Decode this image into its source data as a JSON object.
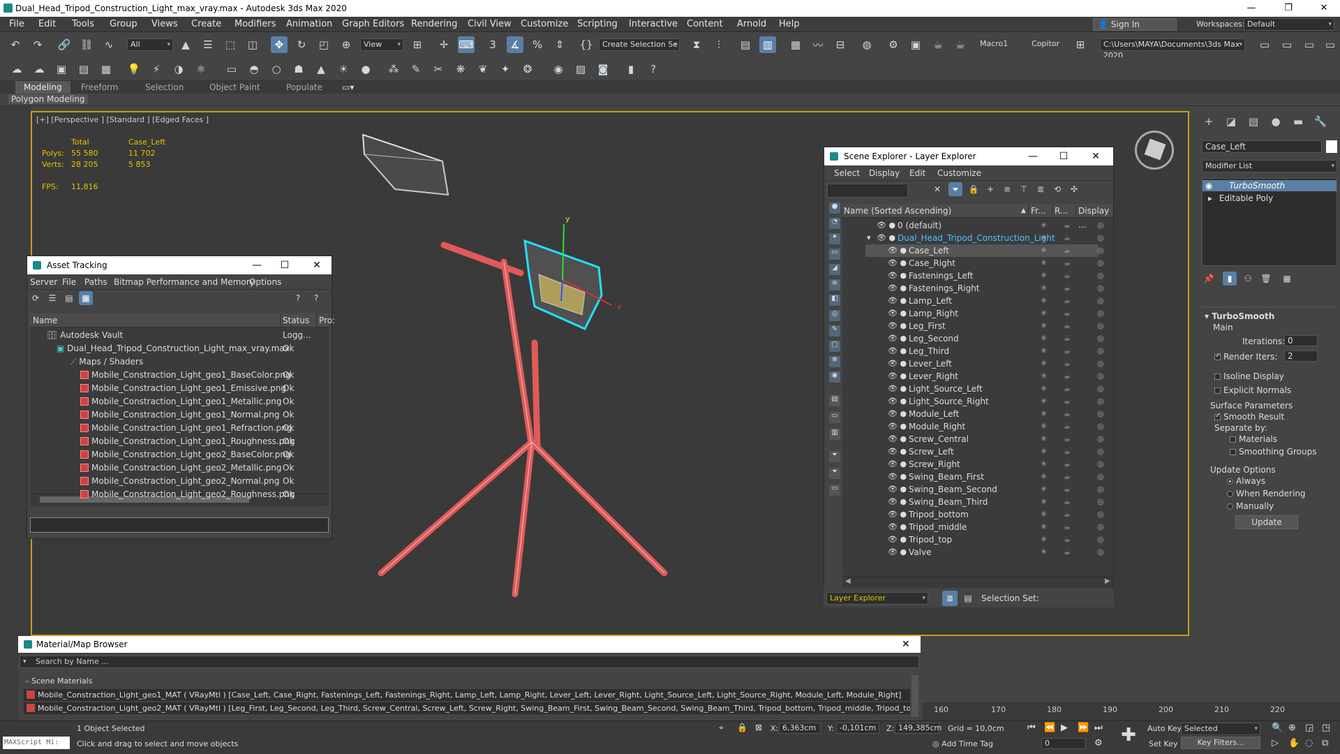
{
  "window": {
    "title": "Dual_Head_Tripod_Construction_Light_max_vray.max - Autodesk 3ds Max 2020",
    "min": "—",
    "max": "❐",
    "close": "✕"
  },
  "menus": [
    "File",
    "Edit",
    "Tools",
    "Group",
    "Views",
    "Create",
    "Modifiers",
    "Animation",
    "Graph Editors",
    "Rendering",
    "Civil View",
    "Customize",
    "Scripting",
    "Interactive",
    "Content",
    "Arnold",
    "Help"
  ],
  "account": {
    "sign_in": "Sign In",
    "workspaces_label": "Workspaces:",
    "workspace": "Default"
  },
  "toolbar": {
    "filter": "All",
    "view": "View",
    "selection_set": "Create Selection Se",
    "macro1": "Macro1",
    "copitor": "Copitor",
    "path": "C:\\Users\\MAYA\\Documents\\3ds Max 2020"
  },
  "ribbon": {
    "tabs": [
      "Modeling",
      "Freeform",
      "Selection",
      "Object Paint",
      "Populate"
    ],
    "active_tab": "Modeling",
    "subpanel": "Polygon Modeling"
  },
  "viewport": {
    "label": "[+] [Perspective ] [Standard ] [Edged Faces ]",
    "stats": {
      "col_total": "Total",
      "col_object": "Case_Left",
      "polys_label": "Polys:",
      "polys_total": "55 580",
      "polys_obj": "11 702",
      "verts_label": "Verts:",
      "verts_total": "28 205",
      "verts_obj": "5 853",
      "fps_label": "FPS:",
      "fps": "11,816"
    },
    "gizmo_x": "x",
    "gizmo_y": "y"
  },
  "asset_tracking": {
    "title": "Asset Tracking",
    "menu": [
      "Server",
      "File",
      "Paths",
      "Bitmap Performance and Memory",
      "Options"
    ],
    "columns": {
      "name": "Name",
      "status": "Status",
      "proxy": "Pro:"
    },
    "vault": {
      "name": "Autodesk Vault",
      "status": "Logg..."
    },
    "maxfile": {
      "name": "Dual_Head_Tripod_Construction_Light_max_vray.max",
      "status": "Ok"
    },
    "maps_folder": "Maps / Shaders",
    "files": [
      {
        "name": "Mobile_Constraction_Light_geo1_BaseColor.png",
        "status": "Ok"
      },
      {
        "name": "Mobile_Constraction_Light_geo1_Emissive.png",
        "status": "Ok"
      },
      {
        "name": "Mobile_Constraction_Light_geo1_Metallic.png",
        "status": "Ok"
      },
      {
        "name": "Mobile_Constraction_Light_geo1_Normal.png",
        "status": "Ok"
      },
      {
        "name": "Mobile_Constraction_Light_geo1_Refraction.png",
        "status": "Ok"
      },
      {
        "name": "Mobile_Constraction_Light_geo1_Roughness.png",
        "status": "Ok"
      },
      {
        "name": "Mobile_Constraction_Light_geo2_BaseColor.png",
        "status": "Ok"
      },
      {
        "name": "Mobile_Constraction_Light_geo2_Metallic.png",
        "status": "Ok"
      },
      {
        "name": "Mobile_Constraction_Light_geo2_Normal.png",
        "status": "Ok"
      },
      {
        "name": "Mobile_Constraction_Light_geo2_Roughness.png",
        "status": "Ok"
      }
    ]
  },
  "scene_explorer": {
    "title": "Scene Explorer - Layer Explorer",
    "menu": [
      "Select",
      "Display",
      "Edit",
      "Customize"
    ],
    "columns": {
      "name": "Name (Sorted Ascending)",
      "freeze": "Fr...",
      "render": "R...",
      "display": "Display ..."
    },
    "default_layer": "0 (default)",
    "group": "Dual_Head_Tripod_Construction_Light",
    "selected": "Case_Left",
    "objects": [
      "Case_Left",
      "Case_Right",
      "Fastenings_Left",
      "Fastenings_Right",
      "Lamp_Left",
      "Lamp_Right",
      "Leg_First",
      "Leg_Second",
      "Leg_Third",
      "Lever_Left",
      "Lever_Right",
      "Light_Source_Left",
      "Light_Source_Right",
      "Module_Left",
      "Module_Right",
      "Screw_Central",
      "Screw_Left",
      "Screw_Right",
      "Swing_Beam_First",
      "Swing_Beam_Second",
      "Swing_Beam_Third",
      "Tripod_bottom",
      "Tripod_middle",
      "Tripod_top",
      "Valve"
    ],
    "footer_combo": "Layer Explorer",
    "selection_set": "Selection Set:"
  },
  "command_panel": {
    "object_name": "Case_Left",
    "modifier_list": "Modifier List",
    "stack": [
      "TurboSmooth",
      "Editable Poly"
    ],
    "turbosmooth": {
      "title": "TurboSmooth",
      "main": "Main",
      "iterations_label": "Iterations:",
      "iterations": "0",
      "render_iters_label": "Render Iters:",
      "render_iters": "2",
      "isoline": "Isoline Display",
      "explicit_normals": "Explicit Normals",
      "surface_params": "Surface Parameters",
      "smooth_result": "Smooth Result",
      "separate_by": "Separate by:",
      "materials": "Materials",
      "smoothing_groups": "Smoothing Groups",
      "update_options": "Update Options",
      "always": "Always",
      "when_rendering": "When Rendering",
      "manually": "Manually",
      "update": "Update"
    }
  },
  "material_browser": {
    "title": "Material/Map Browser",
    "search_placeholder": "Search by Name ...",
    "section": "Scene Materials",
    "materials": [
      "Mobile_Constraction_Light_geo1_MAT ( VRayMtl ) [Case_Left, Case_Right, Fastenings_Left, Fastenings_Right, Lamp_Left, Lamp_Right, Lever_Left, Lever_Right, Light_Source_Left, Light_Source_Right, Module_Left, Module_Right]",
      "Mobile_Constraction_Light_geo2_MAT ( VRayMtl ) [Leg_First, Leg_Second, Leg_Third, Screw_Central, Screw_Left, Screw_Right, Swing_Beam_First, Swing_Beam_Second, Swing_Beam_Third, Tripod_bottom, Tripod_middle, Tripod_top, Valve]"
    ]
  },
  "timeline": {
    "ticks": [
      "160",
      "170",
      "180",
      "190",
      "200",
      "210",
      "220"
    ]
  },
  "status": {
    "maxscript": "MAXScript Mi:",
    "selected": "1 Object Selected",
    "prompt": "Click and drag to select and move objects",
    "x_label": "X:",
    "x": "6,363cm",
    "y_label": "Y:",
    "y": "-0,101cm",
    "z_label": "Z:",
    "z": "149,385cm",
    "grid": "Grid = 10,0cm",
    "add_time_tag": "Add Time Tag",
    "auto_key": "Auto Key",
    "key_mode": "Selected",
    "set_key": "Set Key",
    "key_filters": "Key Filters...",
    "frame": "0"
  },
  "colors": {
    "accent": "#5a7fa5",
    "viewport_border": "#c99a1a",
    "selection": "#22e0ff",
    "wire": "#e05a5a"
  }
}
